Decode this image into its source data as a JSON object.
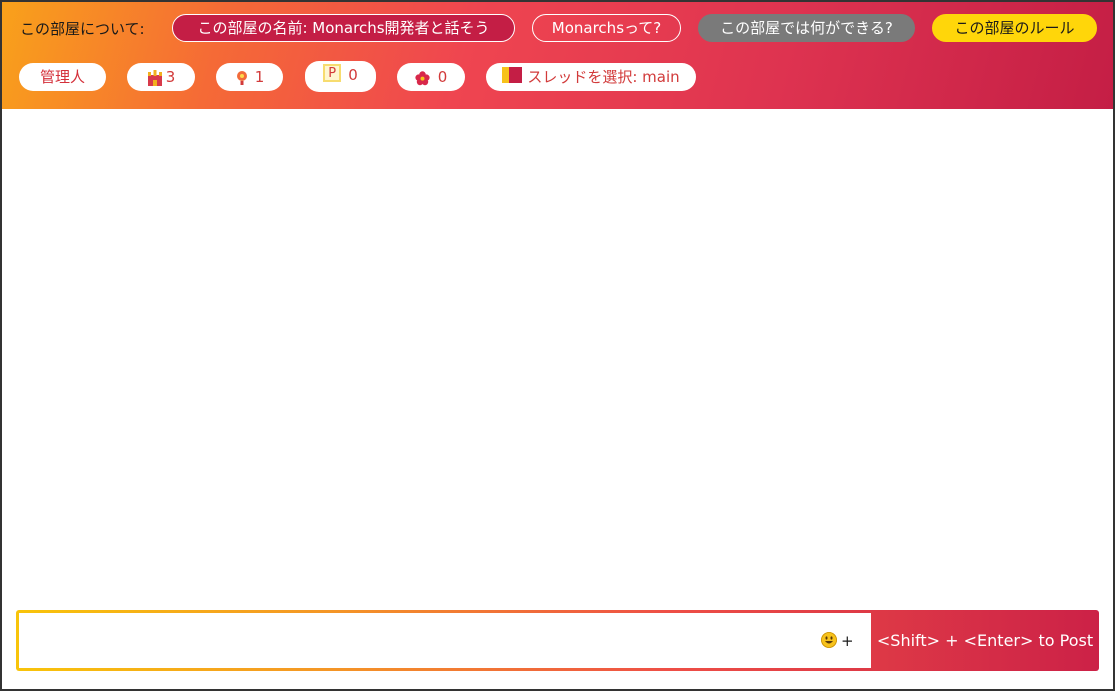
{
  "header": {
    "about_label": "この部屋について:",
    "room_name_button": "この部屋の名前: Monarchs開発者と話そう",
    "what_is_button": "Monarchsって?",
    "what_can_button": "この部屋では何ができる?",
    "rules_button": "この部屋のルール",
    "admin_chip": "管理人",
    "stats": [
      {
        "icon": "castle-icon",
        "value": "3"
      },
      {
        "icon": "lamp-icon",
        "value": "1"
      },
      {
        "icon": "p-icon",
        "icon_text": "P",
        "value": "0"
      },
      {
        "icon": "flower-icon",
        "value": "0"
      }
    ],
    "thread_select": "スレッドを選択: main"
  },
  "composer": {
    "input_value": "",
    "emoji_plus": "+",
    "post_hint": "<Shift> + <Enter> to Post"
  },
  "colors": {
    "room_name_pill": "#c41e45",
    "what_can_pill": "#7a7a7a",
    "rules_pill": "#ffd60a",
    "chip_text": "#d23a3a"
  }
}
